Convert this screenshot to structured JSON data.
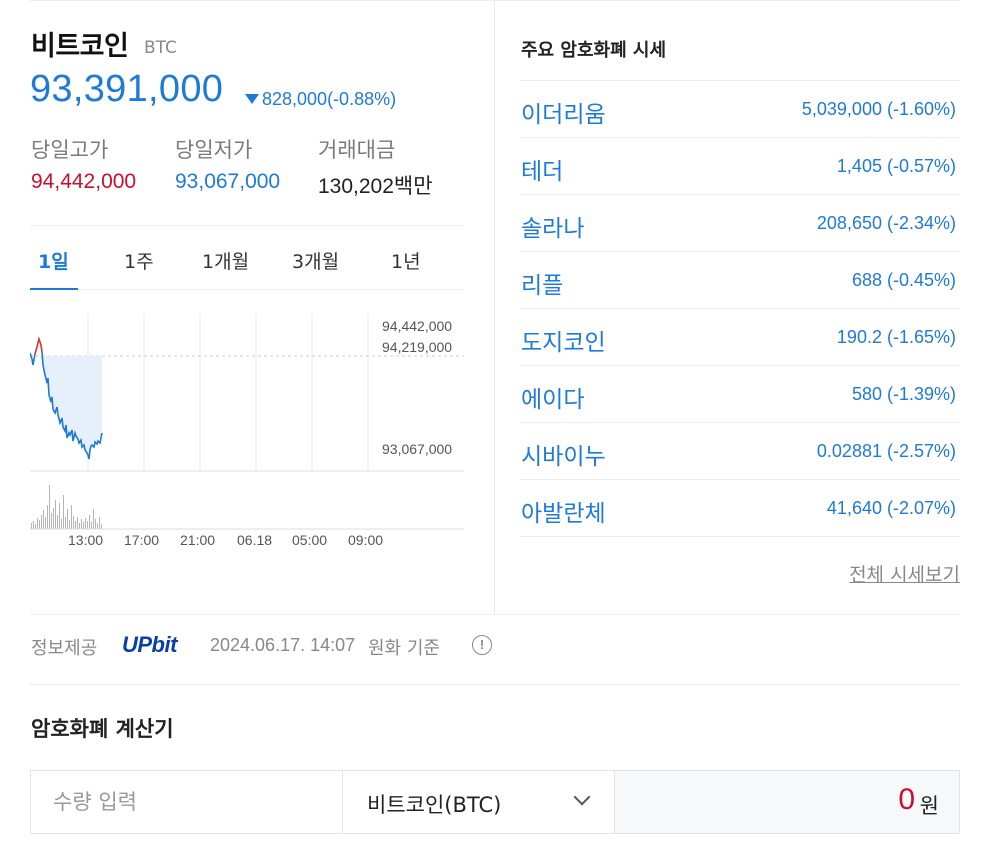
{
  "coin": {
    "name": "비트코인",
    "symbol": "BTC",
    "price": "93,391,000",
    "change": "828,000(-0.88%)",
    "change_direction": "down"
  },
  "stats": [
    {
      "label": "당일고가",
      "value": "94,442,000",
      "color": "#c8102e"
    },
    {
      "label": "당일저가",
      "value": "93,067,000",
      "color": "#1e7ad8"
    },
    {
      "label": "거래대금",
      "value": "130,202백만",
      "color": "#222222"
    }
  ],
  "tabs": [
    "1일",
    "1주",
    "1개월",
    "3개월",
    "1년"
  ],
  "active_tab": "1일",
  "chart": {
    "y_labels": [
      "94,442,000",
      "94,219,000",
      "93,067,000"
    ],
    "x_labels": [
      "13:00",
      "17:00",
      "21:00",
      "06.18",
      "05:00",
      "09:00"
    ],
    "up_color": "#d6342c",
    "down_color": "#1e7ad8"
  },
  "market": {
    "title": "주요 암호화폐 시세",
    "items": [
      {
        "name": "이더리움",
        "value": "5,039,000 (-1.60%)"
      },
      {
        "name": "테더",
        "value": "1,405 (-0.57%)"
      },
      {
        "name": "솔라나",
        "value": "208,650 (-2.34%)"
      },
      {
        "name": "리플",
        "value": "688 (-0.45%)"
      },
      {
        "name": "도지코인",
        "value": "190.2 (-1.65%)"
      },
      {
        "name": "에이다",
        "value": "580 (-1.39%)"
      },
      {
        "name": "시바이누",
        "value": "0.02881 (-2.57%)"
      },
      {
        "name": "아발란체",
        "value": "41,640 (-2.07%)"
      }
    ],
    "view_all": "전체 시세보기"
  },
  "source": {
    "label": "정보제공",
    "provider": "UPbit",
    "timestamp": "2024.06.17. 14:07",
    "basis": "원화 기준",
    "info_icon": "!"
  },
  "calculator": {
    "title": "암호화폐 계산기",
    "quantity_placeholder": "수량 입력",
    "selected_coin": "비트코인(BTC)",
    "result_value": "0",
    "result_unit": "원"
  },
  "colors": {
    "accent_blue": "#1e7ad8",
    "up_red": "#c8102e",
    "upbit_brand": "#0a3fa6"
  }
}
